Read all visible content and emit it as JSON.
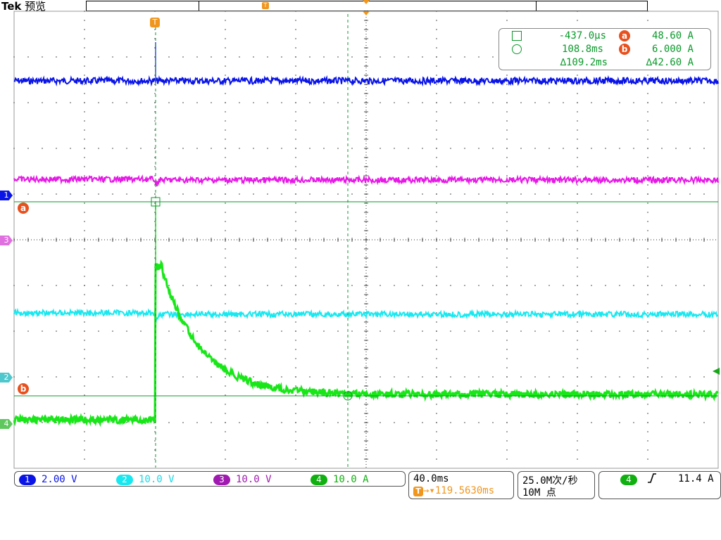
{
  "header": {
    "brand_bold": "Tek",
    "brand_text": "预览"
  },
  "colors": {
    "ch1": "#0a14e6",
    "ch2": "#19e8f0",
    "ch3": "#e619e6",
    "ch4": "#19e619",
    "cursor": "#0a9a2a",
    "trigger": "#f0961e",
    "ref": "#e8501e"
  },
  "markers": {
    "trigger": "T",
    "ch1": "1",
    "ch2": "2",
    "ch3": "3",
    "ch4": "4",
    "cursor_a": "a",
    "cursor_b": "b"
  },
  "cursor_readout": {
    "t1_value": "-437.0µs",
    "t2_value": "108.8ms",
    "dt_value": "∆109.2ms",
    "a_value": "48.60 A",
    "b_value": "6.000 A",
    "da_value": "∆42.60 A"
  },
  "channels": [
    {
      "num": "1",
      "scale": "2.00 V"
    },
    {
      "num": "2",
      "scale": "10.0 V"
    },
    {
      "num": "3",
      "scale": "10.0 V"
    },
    {
      "num": "4",
      "scale": "10.0 A"
    }
  ],
  "timebase": {
    "scale": "40.0ms",
    "trigger_pos": "→▾119.5630ms"
  },
  "acquisition": {
    "rate": "25.0M次/秒",
    "points": "10M 点"
  },
  "trigger": {
    "source": "4",
    "slope_icon": "rising-edge-icon",
    "level": "11.4 A"
  }
}
